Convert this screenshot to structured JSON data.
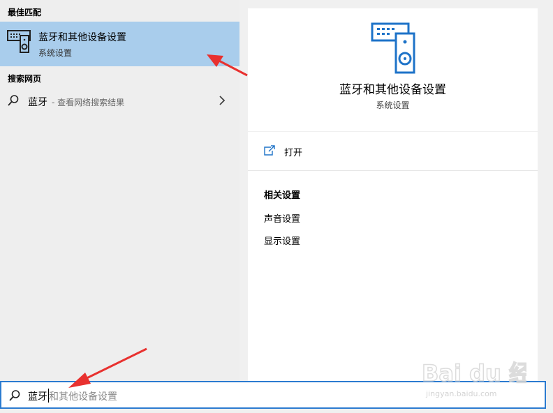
{
  "results_panel": {
    "best_match_header": "最佳匹配",
    "best_match": {
      "title": "蓝牙和其他设备设置",
      "subtitle": "系统设置"
    },
    "web_header": "搜索网页",
    "web_result": {
      "query": "蓝牙",
      "hint": "- 查看网络搜索结果"
    }
  },
  "preview_panel": {
    "title": "蓝牙和其他设备设置",
    "subtitle": "系统设置",
    "open_label": "打开",
    "related_header": "相关设置",
    "related_links": [
      "声音设置",
      "显示设置"
    ]
  },
  "search_bar": {
    "typed_text": "蓝牙",
    "suggestion_text": "和其他设备设置"
  },
  "watermark": {
    "brand": "Bai du 经验",
    "url": "jingyan.baidu.com"
  },
  "colors": {
    "highlight": "#a9cdec",
    "accent": "#2b7bd0",
    "icon_blue": "#1e73c8",
    "arrow_red": "#e8312f"
  }
}
